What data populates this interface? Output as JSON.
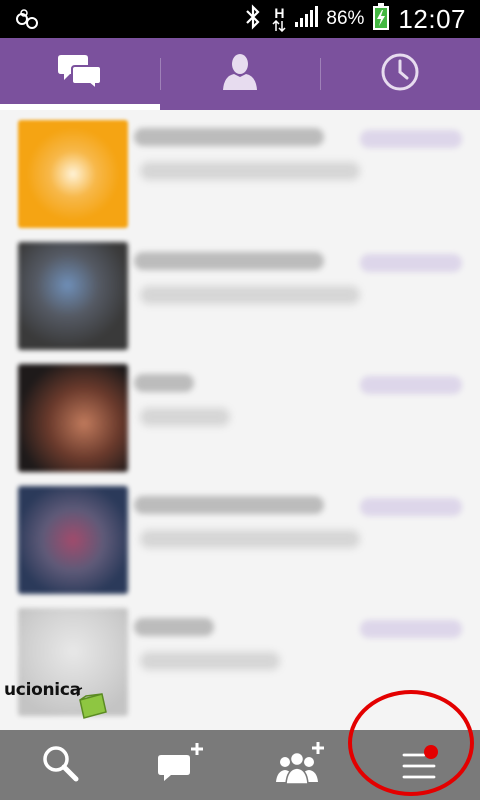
{
  "status_bar": {
    "network_type": "H",
    "battery_percent": "86%",
    "time": "12:07",
    "icons": [
      "voicemail-icon",
      "bluetooth-icon",
      "network-h-icon",
      "signal-icon",
      "battery-charging-icon"
    ]
  },
  "tabs": [
    {
      "icon": "chat-bubbles-icon",
      "active": true
    },
    {
      "icon": "contact-person-icon",
      "active": false
    },
    {
      "icon": "clock-icon",
      "active": false
    }
  ],
  "chats": [
    {
      "avatar_color": "#f5a413"
    },
    {
      "avatar_color": "#5a5f6a"
    },
    {
      "avatar_color": "#6a3a2c"
    },
    {
      "avatar_color": "#5e5a78"
    },
    {
      "avatar_color": "#d2d2d2"
    }
  ],
  "watermark": {
    "text": "ucionica"
  },
  "bottom_bar": {
    "buttons": [
      "search-icon",
      "new-message-icon",
      "add-group-icon",
      "menu-icon"
    ],
    "menu_has_notification": true
  },
  "colors": {
    "accent": "#7b519d",
    "bottom_bar": "#7a7a7a",
    "notification_dot": "#e30000",
    "highlight_ring": "#e30000"
  }
}
